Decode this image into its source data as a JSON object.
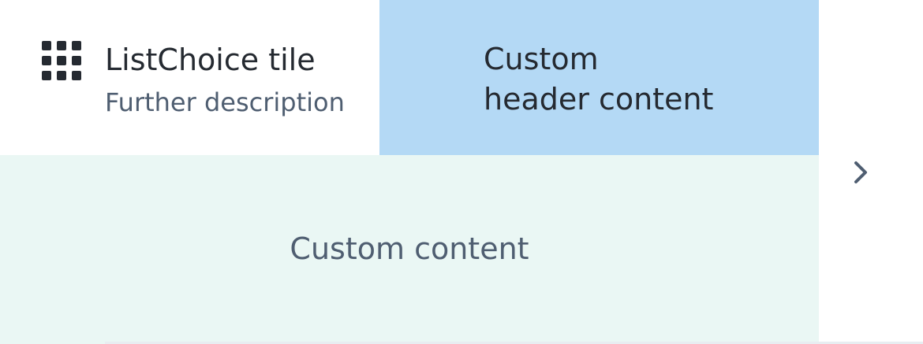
{
  "tile": {
    "icon": "grid-icon",
    "title": "ListChoice tile",
    "description": "Further description"
  },
  "header_custom": {
    "lines": [
      "Custom",
      "header content"
    ]
  },
  "content_custom": {
    "text": "Custom content"
  },
  "expand_control": {
    "icon": "chevron-right-icon"
  },
  "colors": {
    "header_custom_bg": "#b4d9f5",
    "content_custom_bg": "#eaf7f4",
    "title_text": "#252a31",
    "secondary_text": "#4f5e71"
  }
}
